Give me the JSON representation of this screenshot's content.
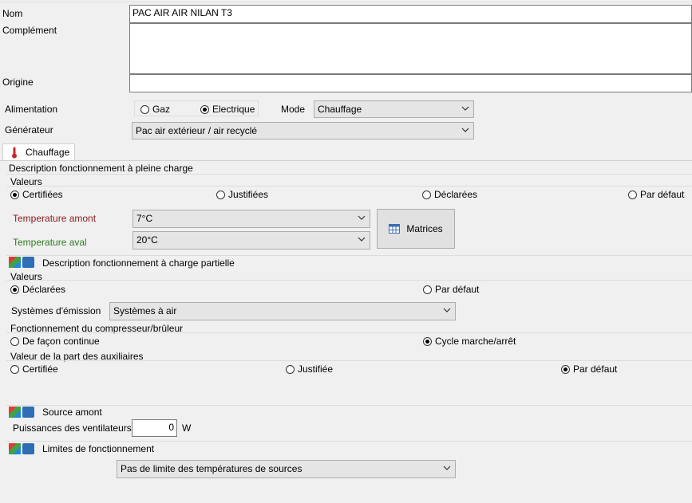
{
  "form": {
    "nom_label": "Nom",
    "nom_value": "PAC AIR AIR NILAN T3",
    "complement_label": "Complément",
    "complement_value": "",
    "origine_label": "Origine",
    "origine_value": ""
  },
  "alimentation": {
    "label": "Alimentation",
    "options": [
      "Gaz",
      "Electrique"
    ],
    "selected": "Electrique"
  },
  "mode": {
    "label": "Mode",
    "value": "Chauffage"
  },
  "generateur": {
    "label": "Générateur",
    "value": "Pac air extérieur / air recyclé"
  },
  "tab": {
    "label": "Chauffage"
  },
  "pleine_charge": {
    "title": "Description fonctionnement à pleine charge",
    "valeurs_label": "Valeurs",
    "options": [
      "Certifiées",
      "Justifiées",
      "Déclarées",
      "Par défaut"
    ],
    "selected": "Certifiées",
    "temp_amont_label": "Temperature amont",
    "temp_amont_value": "7°C",
    "temp_aval_label": "Temperature aval",
    "temp_aval_value": "20°C",
    "matrices_label": "Matrices",
    "colors": {
      "amont": "#8b1a1a",
      "aval": "#2e7d1e"
    }
  },
  "charge_partielle": {
    "title": "Description fonctionnement à charge partielle",
    "valeurs_label": "Valeurs",
    "options": [
      "Déclarées",
      "Par défaut"
    ],
    "selected": "Déclarées",
    "emission_label": "Systèmes d'émission",
    "emission_value": "Systèmes à air",
    "compresseur_label": "Fonctionnement du compresseur/brûleur",
    "compresseur_options": [
      "De façon continue",
      "Cycle marche/arrêt"
    ],
    "compresseur_selected": "Cycle marche/arrêt",
    "auxiliaires_label": "Valeur de la part des auxiliaires",
    "auxiliaires_options": [
      "Certifiée",
      "Justifiée",
      "Par défaut"
    ],
    "auxiliaires_selected": "Par défaut"
  },
  "source_amont": {
    "title": "Source amont",
    "ventilateurs_label": "Puissances des ventilateurs",
    "ventilateurs_value": "0",
    "unit": "W"
  },
  "limites": {
    "title": "Limites de fonctionnement",
    "value": "Pas de limite des températures de sources"
  }
}
